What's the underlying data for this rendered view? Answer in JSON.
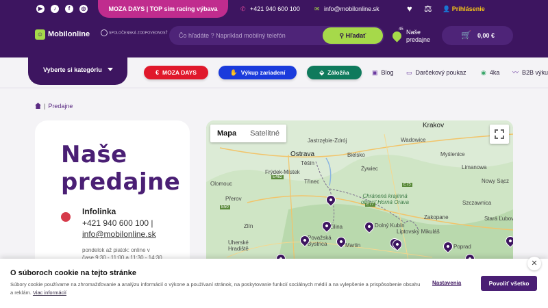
{
  "topbar": {
    "social_icons": [
      "youtube-icon",
      "tiktok-icon",
      "facebook-icon",
      "instagram-icon"
    ],
    "promo": "MOZA DAYS | TOP sim racing výbava",
    "phone": "+421 940 600 100",
    "email": "info@mobilonline.sk",
    "login": "Prihlásenie"
  },
  "header": {
    "logo": "Mobilonline",
    "csr_badge": "SPOLOČENSKÁ ZODPOVEDNOSŤ",
    "search_placeholder": "Čo hľadáte ? Napríklad mobilný telefón",
    "search_button": "Hľadať",
    "stores_badge": "45",
    "stores_label_1": "Naše",
    "stores_label_2": "predajne",
    "cart_total": "0,00 €"
  },
  "nav": {
    "categories": "Vyberte si kategóriu",
    "pills": [
      "MOZA DAYS",
      "Výkup zariadení",
      "Záložňa"
    ],
    "pill_colors": [
      "#e0182b",
      "#1a3bdc",
      "#0f7a5c"
    ],
    "links": [
      "Blog",
      "Darčekový poukaz",
      "4ka",
      "B2B výku"
    ]
  },
  "breadcrumb": {
    "current": "Predajne"
  },
  "card": {
    "title_line1": "Naše",
    "title_line2": "predajne",
    "info_title": "Infolinka",
    "phone": "+421 940 600 100 |",
    "email": "info@mobilonline.sk",
    "hours_1": "pondelok až piatok: online v",
    "hours_2": "čase 9:30 - 11:00 a 11:30 - 14:30"
  },
  "map": {
    "tab_map": "Mapa",
    "tab_satellite": "Satelitné",
    "cities": [
      "Ostrava",
      "Krakov",
      "Jastrzębie-Zdrój",
      "Bielsko",
      "Wadowice",
      "Frýdek-Místek",
      "Třinec",
      "Żywiec",
      "Myślenice",
      "Limanowa",
      "Olomouc",
      "Nowy Sącz",
      "Přerov",
      "Szczawnica",
      "Zakopane",
      "Zlín",
      "Dolný Kubín",
      "Uherské Hradiště",
      "Stará Ľubovňa",
      "Poprad",
      "Žilina",
      "Považská Bystrica",
      "Martin",
      "Liptovský Mikuláš",
      "Těšín",
      "Chránená krajinná oblasť Horná Orava"
    ],
    "roads": [
      "E462",
      "E75",
      "E77",
      "E50"
    ]
  },
  "cookie": {
    "title": "O súboroch cookie na tejto stránke",
    "text": "Súbory cookie používame na zhromažďovanie a analýzu informácií o výkone a používaní stránok, na poskytovanie funkcií sociálnych médií a na vylepšenie a prispôsobenie obsahu a reklám.",
    "more": "Viac informácií",
    "settings": "Nastavenia",
    "accept": "Povoliť všetko"
  }
}
